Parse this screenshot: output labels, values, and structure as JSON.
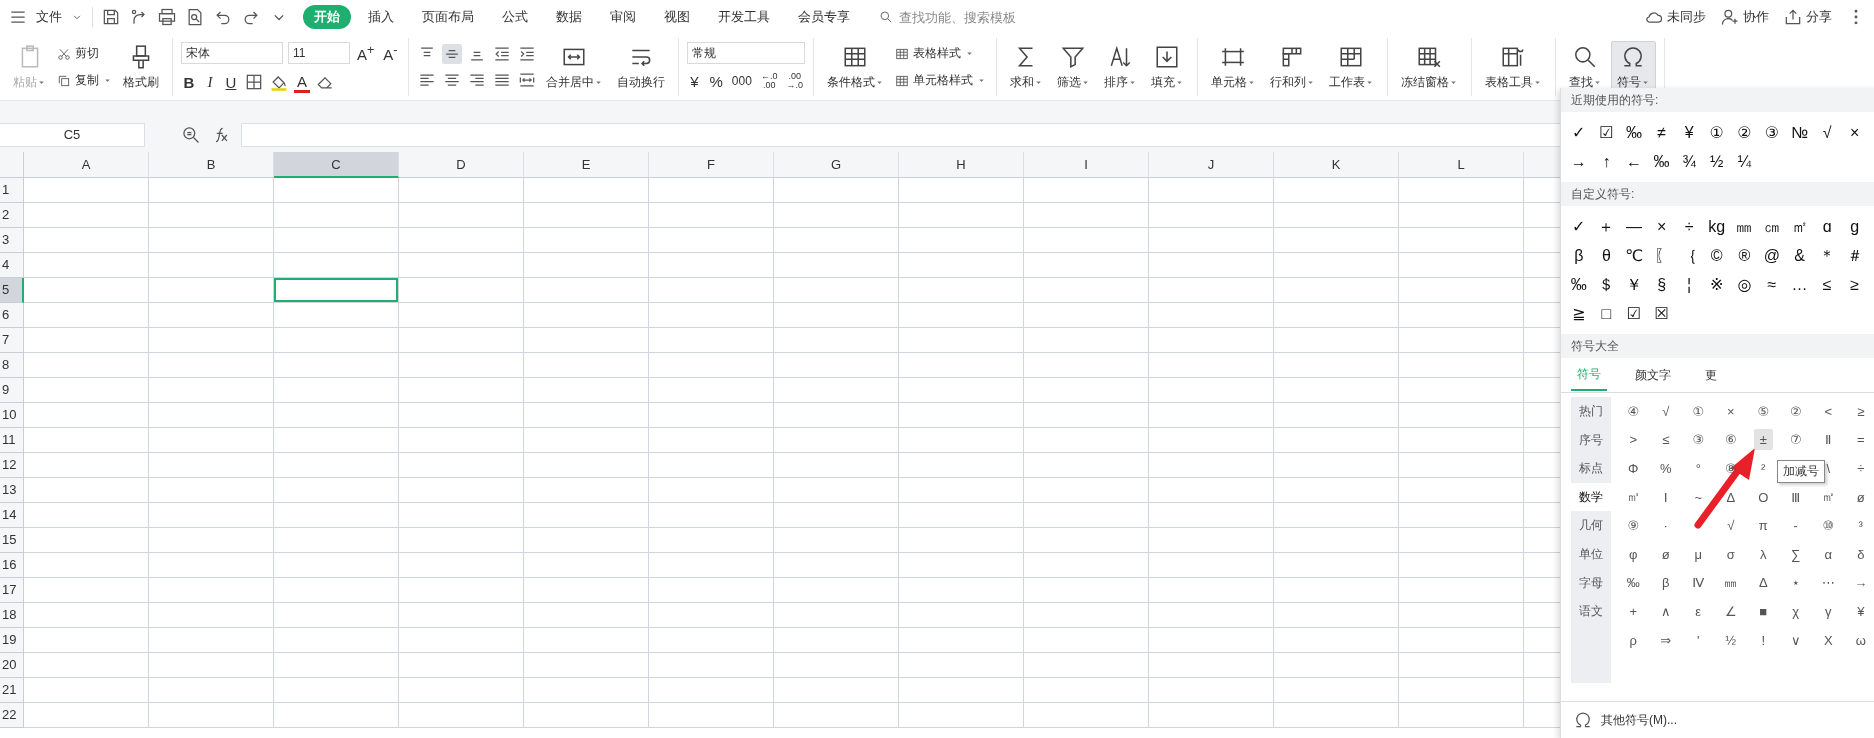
{
  "menu_bar": {
    "file": "文件",
    "tabs": [
      {
        "label": "开始",
        "selected": true
      },
      {
        "label": "插入",
        "selected": false
      },
      {
        "label": "页面布局",
        "selected": false
      },
      {
        "label": "公式",
        "selected": false
      },
      {
        "label": "数据",
        "selected": false
      },
      {
        "label": "审阅",
        "selected": false
      },
      {
        "label": "视图",
        "selected": false
      },
      {
        "label": "开发工具",
        "selected": false
      },
      {
        "label": "会员专享",
        "selected": false
      }
    ],
    "search": {
      "placeholder": "查找功能、搜索模板"
    },
    "actions": [
      "未同步",
      "协作",
      "分享"
    ]
  },
  "ribbon": {
    "clipboard": {
      "paste": {
        "label": "粘贴",
        "disabled": true
      },
      "cut": "剪切",
      "copy": "复制",
      "format_painter": "格式刷"
    },
    "font": {
      "name": "宋体",
      "size": "11",
      "grow": "A$^{+}$",
      "shrink": "A$^{-}$",
      "bold": "B",
      "italic": "I",
      "underline": "U",
      "font_color": "A"
    },
    "alignment": {
      "merge": "合并居中",
      "wrap": "自动换行"
    },
    "number": {
      "format": "常规",
      "currency": "¥",
      "percent": "%",
      "thousands": "000",
      "add_decimal": "←.0\n.00",
      "remove_decimal": ".00\n→.0"
    },
    "groups": [
      {
        "items": [
          {
            "kind": "large",
            "label": "条件格式",
            "selected": false
          },
          {
            "kind": "stack",
            "labels": [
              "表格样式",
              "单元格样式"
            ]
          }
        ]
      },
      {
        "items": [
          {
            "kind": "large",
            "label": "求和",
            "selected": false
          },
          {
            "kind": "large",
            "label": "筛选",
            "selected": false
          },
          {
            "kind": "large",
            "label": "排序",
            "selected": false
          },
          {
            "kind": "large",
            "label": "填充",
            "selected": false
          }
        ]
      },
      {
        "items": [
          {
            "kind": "large",
            "label": "单元格",
            "selected": false
          },
          {
            "kind": "large",
            "label": "行和列",
            "selected": false
          },
          {
            "kind": "large",
            "label": "工作表",
            "selected": false
          }
        ]
      },
      {
        "items": [
          {
            "kind": "large",
            "label": "冻结窗格",
            "selected": false
          }
        ]
      },
      {
        "items": [
          {
            "kind": "large",
            "label": "表格工具",
            "selected": false
          }
        ]
      },
      {
        "items": [
          {
            "kind": "large",
            "label": "查找",
            "selected": false
          },
          {
            "kind": "large",
            "label": "符号",
            "selected": true
          }
        ]
      }
    ]
  },
  "formula_bar": {
    "name_box": "C5"
  },
  "sheet": {
    "columns": [
      {
        "label": "A",
        "selected": false
      },
      {
        "label": "B",
        "selected": false
      },
      {
        "label": "C",
        "selected": true
      },
      {
        "label": "D",
        "selected": false
      },
      {
        "label": "E",
        "selected": false
      },
      {
        "label": "F",
        "selected": false
      },
      {
        "label": "G",
        "selected": false
      },
      {
        "label": "H",
        "selected": false
      },
      {
        "label": "I",
        "selected": false
      },
      {
        "label": "J",
        "selected": false
      },
      {
        "label": "K",
        "selected": false
      },
      {
        "label": "L",
        "selected": false
      }
    ],
    "rows": [
      {
        "label": "1",
        "selected": false
      },
      {
        "label": "2",
        "selected": false
      },
      {
        "label": "3",
        "selected": false
      },
      {
        "label": "4",
        "selected": false
      },
      {
        "label": "5",
        "selected": true
      },
      {
        "label": "6",
        "selected": false
      },
      {
        "label": "7",
        "selected": false
      },
      {
        "label": "8",
        "selected": false
      },
      {
        "label": "9",
        "selected": false
      },
      {
        "label": "10",
        "selected": false
      },
      {
        "label": "11",
        "selected": false
      },
      {
        "label": "12",
        "selected": false
      },
      {
        "label": "13",
        "selected": false
      },
      {
        "label": "14",
        "selected": false
      },
      {
        "label": "15",
        "selected": false
      },
      {
        "label": "16",
        "selected": false
      },
      {
        "label": "17",
        "selected": false
      },
      {
        "label": "18",
        "selected": false
      },
      {
        "label": "19",
        "selected": false
      },
      {
        "label": "20",
        "selected": false
      },
      {
        "label": "21",
        "selected": false
      },
      {
        "label": "22",
        "selected": false
      }
    ]
  },
  "symbol_panel": {
    "recent": {
      "title": "近期使用的符号:",
      "symbols": [
        "✓",
        "☑",
        "‰",
        "≠",
        "¥",
        "①",
        "②",
        "③",
        "№",
        "√",
        "×",
        "→",
        "↑",
        "←",
        "‰",
        "¾",
        "½",
        "¼"
      ]
    },
    "custom": {
      "title": "自定义符号:",
      "symbols": [
        "✓",
        "＋",
        "—",
        "×",
        "÷",
        "kg",
        "㎜",
        "㎝",
        "㎡",
        "ɑ",
        "ɡ",
        "β",
        "θ",
        "℃",
        "〖",
        "｛",
        "©",
        "®",
        "@",
        "&",
        "＊",
        "＃",
        "‰",
        "＄",
        "￥",
        "§",
        "¦",
        "※",
        "◎",
        "≈",
        "…",
        "≤",
        "≥",
        "≧",
        "□",
        "☑",
        "☒"
      ]
    },
    "library": {
      "title": "符号大全",
      "tabs": [
        {
          "label": "符号",
          "selected": true
        },
        {
          "label": "颜文字",
          "selected": false
        },
        {
          "label": "更",
          "selected": false
        }
      ],
      "categories": [
        {
          "label": "热门",
          "selected": false
        },
        {
          "label": "序号",
          "selected": false
        },
        {
          "label": "标点",
          "selected": false
        },
        {
          "label": "数学",
          "selected": true
        },
        {
          "label": "几何",
          "selected": false
        },
        {
          "label": "单位",
          "selected": false
        },
        {
          "label": "字母",
          "selected": false
        },
        {
          "label": "语文",
          "selected": false
        }
      ],
      "symbols": [
        {
          "kind": "symbol",
          "char": "④",
          "hovered": false
        },
        {
          "kind": "symbol",
          "char": "√",
          "hovered": false
        },
        {
          "kind": "symbol",
          "char": "①",
          "hovered": false
        },
        {
          "kind": "symbol",
          "char": "×",
          "hovered": false
        },
        {
          "kind": "symbol",
          "char": "⑤",
          "hovered": false
        },
        {
          "kind": "symbol",
          "char": "②",
          "hovered": false
        },
        {
          "kind": "symbol",
          "char": "<",
          "hovered": false
        },
        {
          "kind": "symbol",
          "char": "≥",
          "hovered": false
        },
        {
          "kind": "symbol",
          "char": ">",
          "hovered": false
        },
        {
          "kind": "symbol",
          "char": "≤",
          "hovered": false
        },
        {
          "kind": "symbol",
          "char": "③",
          "hovered": false
        },
        {
          "kind": "symbol",
          "char": "⑥",
          "hovered": false
        },
        {
          "kind": "symbol",
          "char": "±",
          "hovered": true
        },
        {
          "kind": "symbol",
          "char": "⑦",
          "hovered": false
        },
        {
          "kind": "symbol",
          "char": "Ⅱ",
          "hovered": false
        },
        {
          "kind": "symbol",
          "char": "=",
          "hovered": false
        },
        {
          "kind": "symbol",
          "char": "Φ",
          "hovered": false
        },
        {
          "kind": "symbol",
          "char": "%",
          "hovered": false
        },
        {
          "kind": "symbol",
          "char": "°",
          "hovered": false
        },
        {
          "kind": "symbol",
          "char": "⑧",
          "hovered": false
        },
        {
          "kind": "symbol",
          "char": "²",
          "hovered": false
        },
        {
          "kind": "covered"
        },
        {
          "kind": "symbol",
          "char": "\\",
          "hovered": false
        },
        {
          "kind": "symbol",
          "char": "÷",
          "hovered": false
        },
        {
          "kind": "symbol",
          "char": "㎥",
          "hovered": false
        },
        {
          "kind": "symbol",
          "char": "Ⅰ",
          "hovered": false
        },
        {
          "kind": "symbol",
          "char": "~",
          "hovered": false
        },
        {
          "kind": "symbol",
          "char": "Δ",
          "hovered": false
        },
        {
          "kind": "symbol",
          "char": "Ο",
          "hovered": false
        },
        {
          "kind": "symbol",
          "char": "Ⅲ",
          "hovered": false
        },
        {
          "kind": "symbol",
          "char": "㎡",
          "hovered": false
        },
        {
          "kind": "symbol",
          "char": "ø",
          "hovered": false
        },
        {
          "kind": "symbol",
          "char": "⑨",
          "hovered": false
        },
        {
          "kind": "symbol",
          "char": "·",
          "hovered": false
        },
        {
          "kind": "covered"
        },
        {
          "kind": "symbol",
          "char": "√",
          "hovered": false
        },
        {
          "kind": "symbol",
          "char": "π",
          "hovered": false
        },
        {
          "kind": "symbol",
          "char": "-",
          "hovered": false
        },
        {
          "kind": "symbol",
          "char": "⑩",
          "hovered": false
        },
        {
          "kind": "symbol",
          "char": "³",
          "hovered": false
        },
        {
          "kind": "symbol",
          "char": "φ",
          "hovered": false
        },
        {
          "kind": "symbol",
          "char": "ø",
          "hovered": false
        },
        {
          "kind": "symbol",
          "char": "μ",
          "hovered": false
        },
        {
          "kind": "symbol",
          "char": "σ",
          "hovered": false
        },
        {
          "kind": "symbol",
          "char": "λ",
          "hovered": false
        },
        {
          "kind": "symbol",
          "char": "∑",
          "hovered": false
        },
        {
          "kind": "symbol",
          "char": "α",
          "hovered": false
        },
        {
          "kind": "symbol",
          "char": "δ",
          "hovered": false
        },
        {
          "kind": "symbol",
          "char": "‰",
          "hovered": false
        },
        {
          "kind": "symbol",
          "char": "β",
          "hovered": false
        },
        {
          "kind": "symbol",
          "char": "Ⅳ",
          "hovered": false
        },
        {
          "kind": "symbol",
          "char": "㎜",
          "hovered": false
        },
        {
          "kind": "symbol",
          "char": "Δ",
          "hovered": false
        },
        {
          "kind": "symbol",
          "char": "⋆",
          "hovered": false
        },
        {
          "kind": "symbol",
          "char": "⋯",
          "hovered": false
        },
        {
          "kind": "symbol",
          "char": "→",
          "hovered": false
        },
        {
          "kind": "symbol",
          "char": "+",
          "hovered": false
        },
        {
          "kind": "symbol",
          "char": "∧",
          "hovered": false
        },
        {
          "kind": "symbol",
          "char": "ε",
          "hovered": false
        },
        {
          "kind": "symbol",
          "char": "∠",
          "hovered": false
        },
        {
          "kind": "symbol",
          "char": "■",
          "hovered": false
        },
        {
          "kind": "symbol",
          "char": "χ",
          "hovered": false
        },
        {
          "kind": "symbol",
          "char": "γ",
          "hovered": false
        },
        {
          "kind": "symbol",
          "char": "¥",
          "hovered": false
        },
        {
          "kind": "symbol",
          "char": "ρ",
          "hovered": false
        },
        {
          "kind": "symbol",
          "char": "⇒",
          "hovered": false
        },
        {
          "kind": "symbol",
          "char": "'",
          "hovered": false
        },
        {
          "kind": "symbol",
          "char": "½",
          "hovered": false
        },
        {
          "kind": "symbol",
          "char": "!",
          "hovered": false
        },
        {
          "kind": "symbol",
          "char": "∨",
          "hovered": false
        },
        {
          "kind": "symbol",
          "char": "X",
          "hovered": false
        },
        {
          "kind": "symbol",
          "char": "ω",
          "hovered": false
        }
      ],
      "tooltip": "加减号"
    },
    "footer": "其他符号(M)..."
  }
}
